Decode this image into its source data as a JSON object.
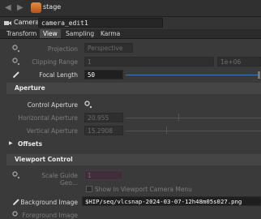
{
  "nav": {
    "back_icon": "left-arrow-icon",
    "forward_icon": "right-arrow-icon",
    "stage_label": "stage"
  },
  "camera": {
    "type_label": "Camera",
    "node_name": "camera_edit1"
  },
  "tabs": [
    {
      "label": "Transform",
      "active": false
    },
    {
      "label": "View",
      "active": true
    },
    {
      "label": "Sampling",
      "active": false
    },
    {
      "label": "Karma",
      "active": false
    }
  ],
  "view": {
    "projection_label": "Projection",
    "projection_value": "Perspective",
    "clipping_label": "Clipping Range",
    "clipping_near": "1",
    "clipping_far": "1e+06",
    "focal_label": "Focal Length",
    "focal_value": "50"
  },
  "aperture": {
    "section_label": "Aperture",
    "control_label": "Control Aperture",
    "horizontal_label": "Horizontal Aperture",
    "horizontal_value": "20.955",
    "vertical_label": "Vertical Aperture",
    "vertical_value": "15.2908"
  },
  "offsets": {
    "section_label": "Offsets"
  },
  "viewport": {
    "section_label": "Viewport Control",
    "scale_guide_label": "Scale Guide Geo...",
    "scale_guide_value": "1",
    "show_in_menu_label": "Show In Viewport Camera Menu",
    "background_label": "Background Image",
    "background_value": "$HIP/seq/vlcsnap-2024-03-07-12h48m05s027.png",
    "foreground_label": "Foreground Image"
  },
  "colors": {
    "accent": "#3b76c2",
    "stage_icon": "#e58a3c"
  }
}
